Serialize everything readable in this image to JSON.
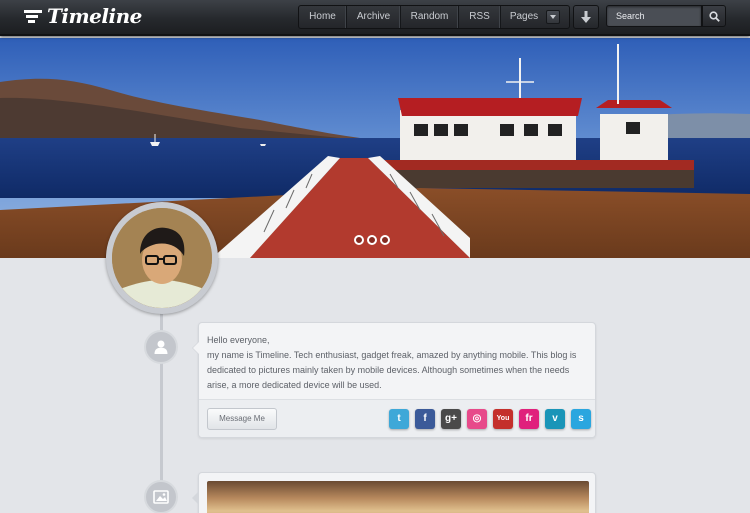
{
  "header": {
    "logo_text": "Timeline",
    "nav": [
      {
        "label": "Home"
      },
      {
        "label": "Archive"
      },
      {
        "label": "Random"
      },
      {
        "label": "RSS"
      },
      {
        "label": "Pages"
      }
    ],
    "search_placeholder": "Search"
  },
  "hero": {
    "slide_count": 3,
    "active_slide": 1
  },
  "about": {
    "greeting": "Hello everyone,",
    "body": "my name is Timeline. Tech enthusiast, gadget freak, amazed by anything mobile. This blog is dedicated to pictures mainly taken by mobile devices. Although sometimes when the needs arise, a more dedicated device will be used.",
    "message_button": "Message Me"
  },
  "social": [
    {
      "name": "twitter-icon",
      "glyph": "t",
      "color": "#3ea8d8"
    },
    {
      "name": "facebook-icon",
      "glyph": "f",
      "color": "#3b5a99"
    },
    {
      "name": "google-plus-icon",
      "glyph": "g+",
      "color": "#4a4a4a"
    },
    {
      "name": "dribbble-icon",
      "glyph": "◎",
      "color": "#e74a8a"
    },
    {
      "name": "youtube-icon",
      "glyph": "You",
      "color": "#c4302b"
    },
    {
      "name": "flickr-icon",
      "glyph": "fr",
      "color": "#e0207c"
    },
    {
      "name": "vimeo-icon",
      "glyph": "v",
      "color": "#1a95b8"
    },
    {
      "name": "skype-icon",
      "glyph": "s",
      "color": "#2aa6df"
    }
  ]
}
